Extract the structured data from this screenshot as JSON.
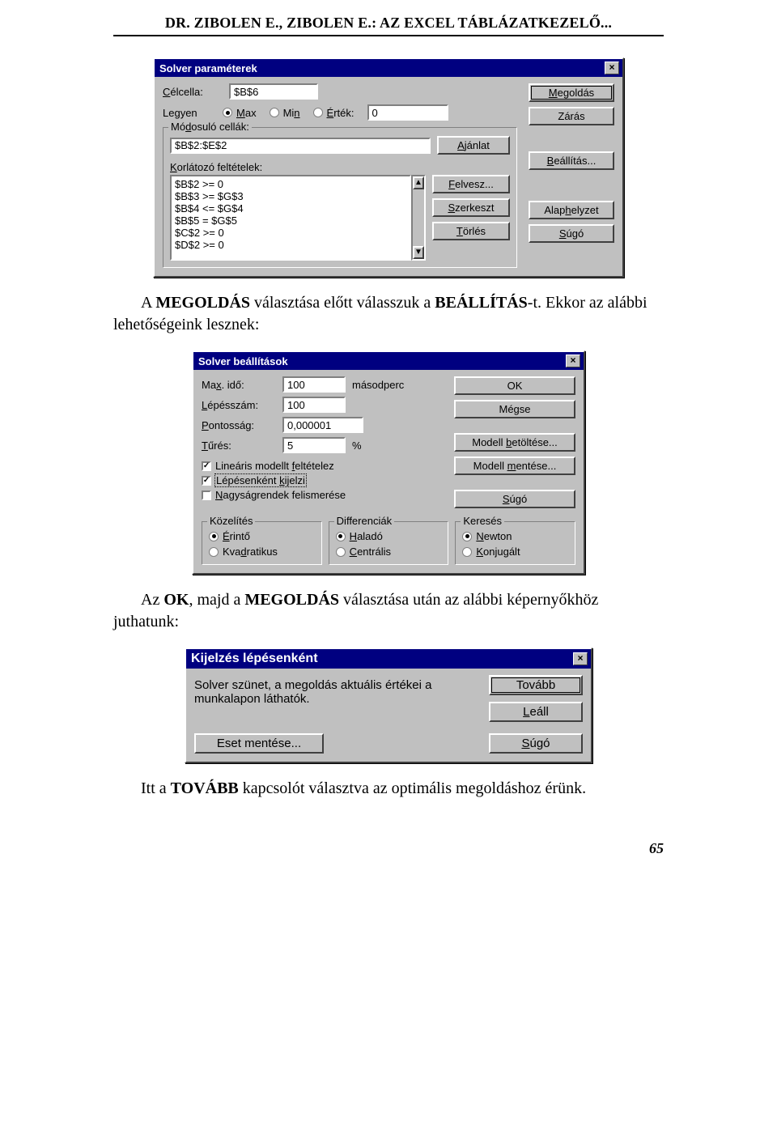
{
  "header": "DR. ZIBOLEN E., ZIBOLEN E.: AZ EXCEL TÁBLÁZATKEZELŐ...",
  "page_number": "65",
  "para1_pre": "A ",
  "para1_b1": "MEGOLDÁS",
  "para1_mid": " választása előtt válasszuk a ",
  "para1_b2": "BEÁLLÍTÁS",
  "para1_post": "-t. Ekkor az alábbi lehetőségeink lesznek:",
  "para2_pre": "Az ",
  "para2_b1": "OK",
  "para2_mid": ", majd a ",
  "para2_b2": "MEGOLDÁS",
  "para2_post": " választása után az alábbi képernyőkhöz juthatunk:",
  "para3_pre": "Itt a ",
  "para3_b1": "TOVÁBB",
  "para3_post": " kapcsolót választva az optimális megoldáshoz érünk.",
  "dlg1": {
    "title": "Solver paraméterek",
    "close": "×",
    "lbl_celcella": "Célcella:",
    "val_celcella": "$B$6",
    "lbl_legyen": "Legyen",
    "radio_max": "Max",
    "radio_min": "Min",
    "radio_ertek_pre": "É",
    "radio_ertek_post": "rték:",
    "val_ertek": "0",
    "grp_modosulo": "Módosuló cellák:",
    "val_modosulo": "$B$2:$E$2",
    "btn_ajanlat_pre": "A",
    "btn_ajanlat_post": "jánlat",
    "lbl_korlatozo": "Korlátozó feltételek:",
    "constraints": [
      "$B$2 >= 0",
      "$B$3 >= $G$3",
      "$B$4 <= $G$4",
      "$B$5 = $G$5",
      "$C$2 >= 0",
      "$D$2 >= 0"
    ],
    "btn_felvesz_pre": "F",
    "btn_felvesz_post": "elvesz...",
    "btn_szerkeszt_pre": "S",
    "btn_szerkeszt_post": "zerkeszt",
    "btn_torles_pre": "T",
    "btn_torles_post": "örlés",
    "btn_megoldas_pre": "M",
    "btn_megoldas_post": "egoldás",
    "btn_zaras": "Zárás",
    "btn_beallitas_pre": "B",
    "btn_beallitas_post": "eállítás...",
    "btn_alaphelyzet_pre": "Alap",
    "btn_alaphelyzet_post": "helyzet",
    "btn_sugo_pre": "S",
    "btn_sugo_post": "úgó",
    "scroll_up": "▲",
    "scroll_dn": "▼"
  },
  "dlg2": {
    "title": "Solver beállítások",
    "close": "×",
    "lbl_maxido": "Max. idő:",
    "val_maxido": "100",
    "unit_maxido": "másodperc",
    "lbl_lepesszam_pre": "L",
    "lbl_lepesszam_post": "épésszám:",
    "val_lepesszam": "100",
    "lbl_pontossag_pre": "P",
    "lbl_pontossag_post": "ontosság:",
    "val_pontossag": "0,000001",
    "lbl_tures_pre": "T",
    "lbl_tures_post": "űrés:",
    "val_tures": "5",
    "unit_tures": "%",
    "chk_linearis_pre": "Lineáris modellt ",
    "chk_linearis_ul": "f",
    "chk_linearis_post": "eltételez",
    "chk_lepesenkent_pre": "Lépésenként ",
    "chk_lepesenkent_ul": "k",
    "chk_lepesenkent_post": "ijelzi",
    "chk_nagysag_pre": "N",
    "chk_nagysag_post": "agyságrendek felismerése",
    "grp_kozelites": "Közelítés",
    "rad_erinto_pre": "É",
    "rad_erinto_post": "rintő",
    "rad_kvad_pre": "Kva",
    "rad_kvad_ul": "d",
    "rad_kvad_post": "ratikus",
    "grp_diff": "Differenciák",
    "rad_halado_pre": "H",
    "rad_halado_post": "aladó",
    "rad_centralis_pre": "C",
    "rad_centralis_post": "entrális",
    "grp_kereses": "Keresés",
    "rad_newton_pre": "N",
    "rad_newton_post": "ewton",
    "rad_konj_pre": "K",
    "rad_konj_post": "onjugált",
    "btn_ok": "OK",
    "btn_megse": "Mégse",
    "btn_betolt_pre": "Modell ",
    "btn_betolt_ul": "b",
    "btn_betolt_post": "etöltése...",
    "btn_mentes_pre": "Modell ",
    "btn_mentes_ul": "m",
    "btn_mentes_post": "entése...",
    "btn_sugo_pre": "S",
    "btn_sugo_post": "úgó"
  },
  "dlg3": {
    "title": "Kijelzés lépésenként",
    "close": "×",
    "msg": "Solver szünet, a megoldás aktuális értékei a munkalapon láthatók.",
    "btn_tovabb": "Tovább",
    "btn_leall_pre": "L",
    "btn_leall_post": "eáll",
    "btn_esetmentes": "Eset mentése...",
    "btn_sugo_pre": "S",
    "btn_sugo_post": "úgó"
  }
}
